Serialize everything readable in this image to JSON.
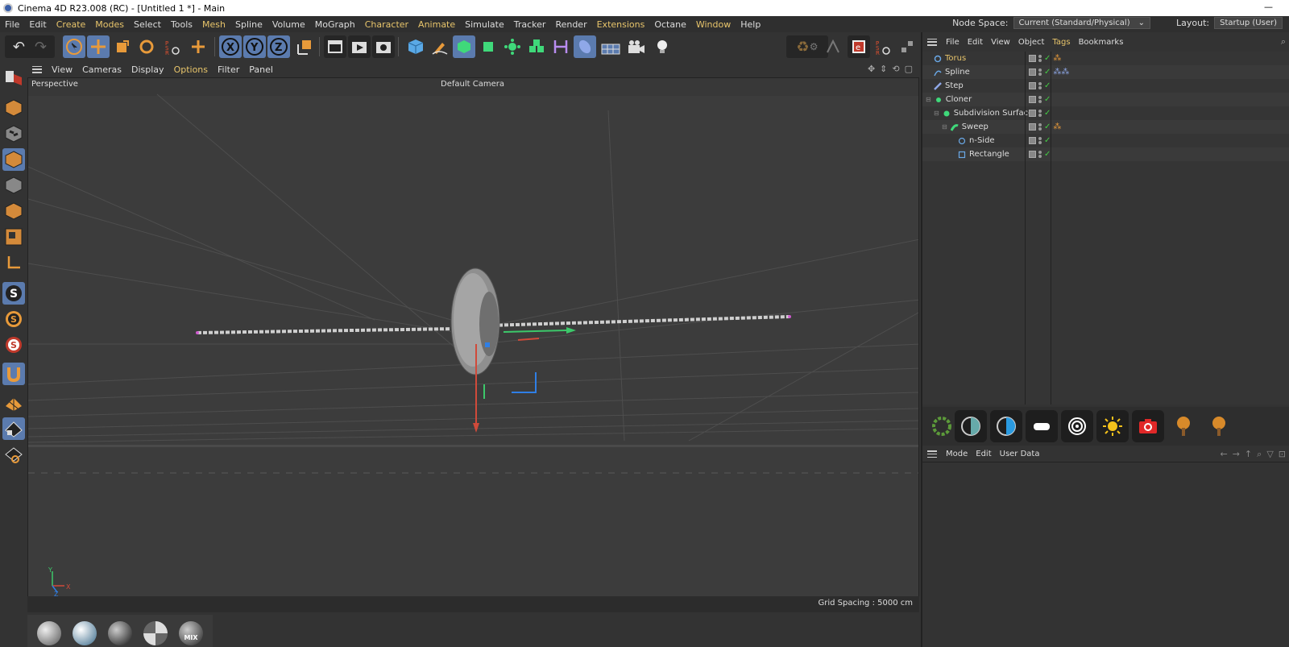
{
  "window": {
    "title": "Cinema 4D R23.008 (RC) - [Untitled 1 *] - Main"
  },
  "menubar": {
    "items": [
      "File",
      "Edit",
      "Create",
      "Modes",
      "Select",
      "Tools",
      "Mesh",
      "Spline",
      "Volume",
      "MoGraph",
      "Character",
      "Animate",
      "Simulate",
      "Tracker",
      "Render",
      "Extensions",
      "Octane",
      "Window",
      "Help"
    ],
    "node_space_label": "Node Space:",
    "node_space_value": "Current (Standard/Physical)",
    "layout_label": "Layout:",
    "layout_value": "Startup (User)"
  },
  "viewport": {
    "menu": [
      "View",
      "Cameras",
      "Display",
      "Options",
      "Filter",
      "Panel"
    ],
    "view_name": "Perspective",
    "camera": "Default Camera",
    "grid_spacing": "Grid Spacing : 5000 cm",
    "axis_y": "Y",
    "axis_x": "X",
    "axis_z": "Z"
  },
  "object_manager": {
    "menu": [
      "File",
      "Edit",
      "View",
      "Object",
      "Tags",
      "Bookmarks"
    ],
    "objects": [
      {
        "name": "Torus",
        "icon": "torus-icon",
        "selected": true,
        "indent": 0
      },
      {
        "name": "Spline",
        "icon": "spline-icon",
        "selected": false,
        "indent": 0
      },
      {
        "name": "Step",
        "icon": "step-icon",
        "selected": false,
        "indent": 0
      },
      {
        "name": "Cloner",
        "icon": "cloner-icon",
        "selected": false,
        "indent": 0
      },
      {
        "name": "Subdivision Surface",
        "icon": "subdivision-icon",
        "selected": false,
        "indent": 1
      },
      {
        "name": "Sweep",
        "icon": "sweep-icon",
        "selected": false,
        "indent": 2
      },
      {
        "name": "n-Side",
        "icon": "nside-icon",
        "selected": false,
        "indent": 3
      },
      {
        "name": "Rectangle",
        "icon": "rectangle-icon",
        "selected": false,
        "indent": 3
      }
    ]
  },
  "attributes": {
    "menu": [
      "Mode",
      "Edit",
      "User Data"
    ]
  },
  "materials": {
    "mix_label": "MIX"
  },
  "colors": {
    "accent": "#e8c56b",
    "active_tool": "#5b7bae",
    "check": "#44cc44"
  }
}
